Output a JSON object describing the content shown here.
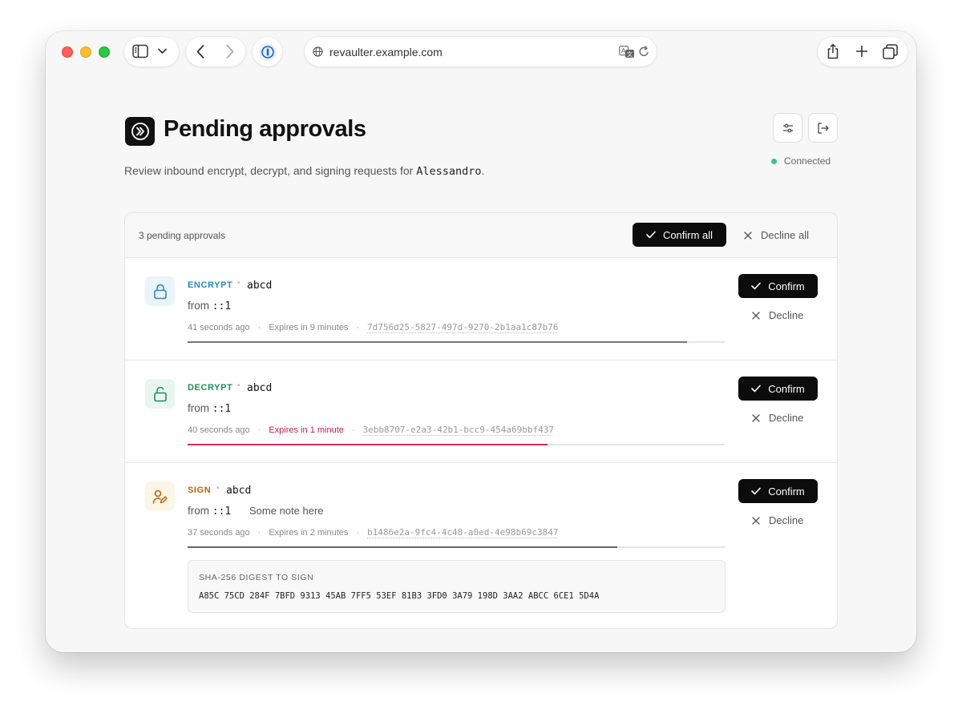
{
  "browser": {
    "url": "revaulter.example.com"
  },
  "header": {
    "title": "Pending approvals",
    "subtitle_prefix": "Review inbound encrypt, decrypt, and signing requests for ",
    "user": "Alessandro",
    "subtitle_suffix": ".",
    "status": "Connected",
    "status_color": "#3cc18a"
  },
  "panel": {
    "count_label": "3 pending approvals",
    "confirm_all": "Confirm all",
    "decline_all": "Decline all"
  },
  "requests": [
    {
      "operation": "ENCRYPT",
      "operation_color": "#2a86c4",
      "key_name": "abcd",
      "from_label": "from",
      "from_addr": "::1",
      "note": "",
      "age": "41 seconds ago",
      "expires": "Expires in 9 minutes",
      "expires_urgent": false,
      "request_id": "7d756d25-5827-497d-9270-2b1aa1c87b76",
      "time_remaining_fraction": 0.93,
      "confirm_label": "Confirm",
      "decline_label": "Decline",
      "icon": "lock-icon"
    },
    {
      "operation": "DECRYPT",
      "operation_color": "#1f8c5a",
      "key_name": "abcd",
      "from_label": "from",
      "from_addr": "::1",
      "note": "",
      "age": "40 seconds ago",
      "expires": "Expires in 1 minute",
      "expires_urgent": true,
      "request_id": "3ebb8707-e2a3-42b1-bcc9-454a69bbf437",
      "time_remaining_fraction": 0.67,
      "confirm_label": "Confirm",
      "decline_label": "Decline",
      "icon": "unlock-icon"
    },
    {
      "operation": "SIGN",
      "operation_color": "#b8650b",
      "key_name": "abcd",
      "from_label": "from",
      "from_addr": "::1",
      "note": "Some note here",
      "age": "37 seconds ago",
      "expires": "Expires in 2 minutes",
      "expires_urgent": false,
      "request_id": "b1486e2a-9fc4-4c48-a0ed-4e98b69c3847",
      "time_remaining_fraction": 0.8,
      "confirm_label": "Confirm",
      "decline_label": "Decline",
      "icon": "pen-signature-icon",
      "digest_label": "SHA-256 DIGEST TO SIGN",
      "digest_value": "A85C 75CD 284F 7BFD 9313 45AB 7FF5 53EF 81B3 3FD0 3A79 198D 3AA2 ABCC 6CE1 5D4A"
    }
  ]
}
